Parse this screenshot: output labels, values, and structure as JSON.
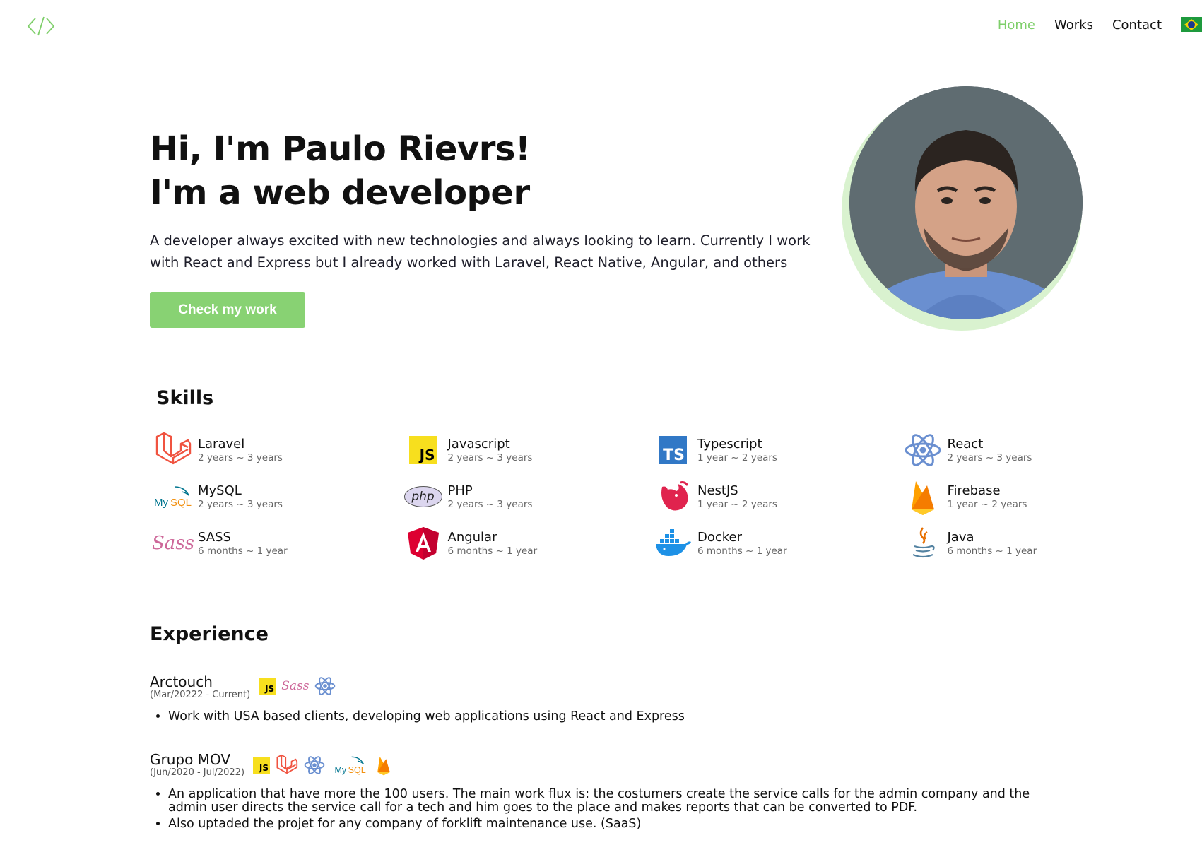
{
  "nav": {
    "items": [
      {
        "label": "Home",
        "active": true
      },
      {
        "label": "Works",
        "active": false
      },
      {
        "label": "Contact",
        "active": false
      }
    ],
    "language_flag": "brazil-flag-icon"
  },
  "hero": {
    "title_line1": "Hi, I'm Paulo Rievrs!",
    "title_line2": "I'm a web developer",
    "description": "A developer always excited with new technologies and always looking to learn. Currently I work with React and Express but I already worked with Laravel, React Native, Angular, and others",
    "cta_label": "Check my work"
  },
  "skills": {
    "title": "Skills",
    "items": [
      {
        "name": "Laravel",
        "duration": "2 years ~ 3 years",
        "icon": "laravel-icon"
      },
      {
        "name": "Javascript",
        "duration": "2 years ~ 3 years",
        "icon": "javascript-icon"
      },
      {
        "name": "Typescript",
        "duration": "1 year ~ 2 years",
        "icon": "typescript-icon"
      },
      {
        "name": "React",
        "duration": "2 years ~ 3 years",
        "icon": "react-icon"
      },
      {
        "name": "MySQL",
        "duration": "2 years ~ 3 years",
        "icon": "mysql-icon"
      },
      {
        "name": "PHP",
        "duration": "2 years ~ 3 years",
        "icon": "php-icon"
      },
      {
        "name": "NestJS",
        "duration": "1 year ~ 2 years",
        "icon": "nestjs-icon"
      },
      {
        "name": "Firebase",
        "duration": "1 year ~ 2 years",
        "icon": "firebase-icon"
      },
      {
        "name": "SASS",
        "duration": "6 months ~ 1 year",
        "icon": "sass-icon"
      },
      {
        "name": "Angular",
        "duration": "6 months ~ 1 year",
        "icon": "angular-icon"
      },
      {
        "name": "Docker",
        "duration": "6 months ~ 1 year",
        "icon": "docker-icon"
      },
      {
        "name": "Java",
        "duration": "6 months ~ 1 year",
        "icon": "java-icon"
      }
    ]
  },
  "experience": {
    "title": "Experience",
    "jobs": [
      {
        "company": "Arctouch",
        "period": "(Mar/20222 - Current)",
        "tech_icons": [
          "javascript-icon",
          "sass-icon",
          "react-icon"
        ],
        "bullets": [
          "Work with USA based clients, developing web applications using React and Express"
        ]
      },
      {
        "company": "Grupo MOV",
        "period": "(Jun/2020 - Jul/2022)",
        "tech_icons": [
          "javascript-icon",
          "laravel-icon",
          "react-icon",
          "mysql-icon",
          "firebase-icon"
        ],
        "bullets": [
          "An application that have more the 100 users. The main work flux is: the costumers create the service calls for the admin company and the admin user directs the service call for a tech and him goes to the place and makes reports that can be converted to PDF.",
          "Also uptaded the projet for any company of forklift maintenance use. (SaaS)"
        ]
      }
    ]
  },
  "icon_text": {
    "js": "JS",
    "ts": "TS",
    "php": "php",
    "mysql": "MySQL",
    "sass": "Sass"
  },
  "colors": {
    "accent": "#7fcf6b",
    "button": "#88d273",
    "avatar_ring": "#d9f2cf"
  }
}
